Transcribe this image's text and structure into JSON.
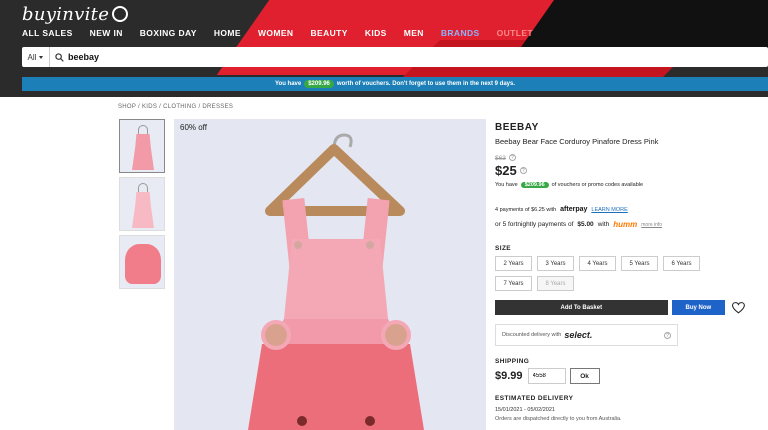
{
  "header": {
    "logo": "buyinvite",
    "nav": [
      "ALL SALES",
      "NEW IN",
      "BOXING DAY",
      "HOME",
      "WOMEN",
      "BEAUTY",
      "KIDS",
      "MEN",
      "BRANDS",
      "OUTLET"
    ]
  },
  "search": {
    "category": "All",
    "value": "beebay"
  },
  "voucher_bar": {
    "prefix": "You have",
    "amount": "$209.96",
    "suffix": "worth of vouchers. Don't forget to use them in the next 9 days."
  },
  "breadcrumb": "SHOP / KIDS / CLOTHING / DRESSES",
  "main_image": {
    "badge": "60% off"
  },
  "product": {
    "brand": "BEEBAY",
    "title": "Beebay Bear Face Corduroy Pinafore Dress Pink",
    "was_price": "$63",
    "price": "$25",
    "voucher_prefix": "You have",
    "voucher_amount": "$209.96",
    "voucher_suffix": "of vouchers or promo codes available"
  },
  "payments": {
    "afterpay_text": "4 payments of $6.25 with",
    "afterpay_brand": "afterpay",
    "afterpay_link": "LEARN MORE",
    "humm_prefix": "or 5 fortnightly payments of",
    "humm_amount": "$5.00",
    "humm_with": "with",
    "humm_brand": "humm",
    "humm_link": "more info"
  },
  "size": {
    "label": "SIZE",
    "options": [
      "2 Years",
      "3 Years",
      "4 Years",
      "5 Years",
      "6 Years",
      "7 Years",
      "8 Years"
    ]
  },
  "actions": {
    "basket": "Add To Basket",
    "buy": "Buy Now"
  },
  "select_delivery": {
    "text": "Discounted delivery with",
    "brand": "select."
  },
  "shipping": {
    "label": "SHIPPING",
    "price": "$9.99",
    "postcode": "4558",
    "ok": "Ok"
  },
  "delivery": {
    "label": "ESTIMATED DELIVERY",
    "dates": "15/01/2021 - 05/02/2021",
    "note": "Orders are dispatched directly to you from Australia."
  },
  "colors": {
    "voucher_bar": "#1d7fb8",
    "voucher_pill": "#37a846",
    "buy_now": "#1e63c8",
    "basket": "#333333",
    "dress": "#f29aa8",
    "header_red": "#e0202f"
  }
}
